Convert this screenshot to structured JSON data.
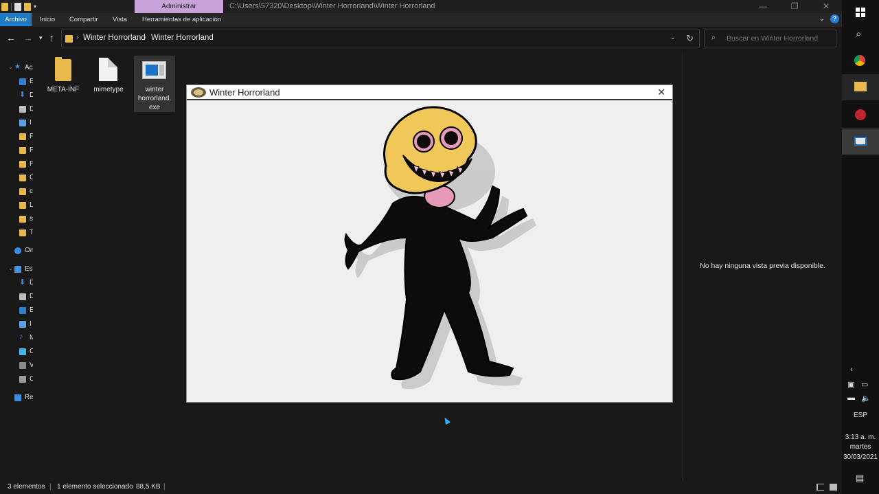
{
  "explorer": {
    "context_tab": "Administrar",
    "title_path": "C:\\Users\\57320\\Desktop\\Winter Horrorland\\Winter Horrorland",
    "ribbon_tabs": [
      "Archivo",
      "Inicio",
      "Compartir",
      "Vista",
      "Herramientas de aplicación"
    ],
    "breadcrumb": [
      "Winter Horrorland",
      "Winter Horrorland"
    ],
    "search_placeholder": "Buscar en Winter Horrorland",
    "sidebar_items": [
      "Ac",
      "E",
      "D",
      "D",
      "I",
      "F",
      "F",
      "F",
      "C",
      "c",
      "L",
      "s",
      "T",
      "On",
      "Es",
      "D",
      "D",
      "E",
      "I",
      "M",
      "C",
      "V",
      "C",
      "Re"
    ],
    "files": [
      {
        "name": "META-INF",
        "type": "folder"
      },
      {
        "name": "mimetype",
        "type": "file"
      },
      {
        "name_line1": "winter",
        "name_line2": "horrorland.",
        "name_line3": "exe",
        "type": "exe"
      }
    ],
    "preview_message": "No hay ninguna vista previa disponible.",
    "status": {
      "count": "3 elementos",
      "selected": "1 elemento seleccionado",
      "size": "88,5 KB"
    }
  },
  "app": {
    "title": "Winter Horrorland",
    "close_glyph": "✕"
  },
  "taskbar": {
    "language": "ESP",
    "time": "3:13 a. m.",
    "day": "martes",
    "date": "30/03/2021"
  },
  "colors": {
    "accent": "#1e7bc7",
    "context_tab": "#c7a3da",
    "character_head": "#f0c85a",
    "character_body": "#0e0b0b",
    "character_mouth": "#e79ab8"
  }
}
